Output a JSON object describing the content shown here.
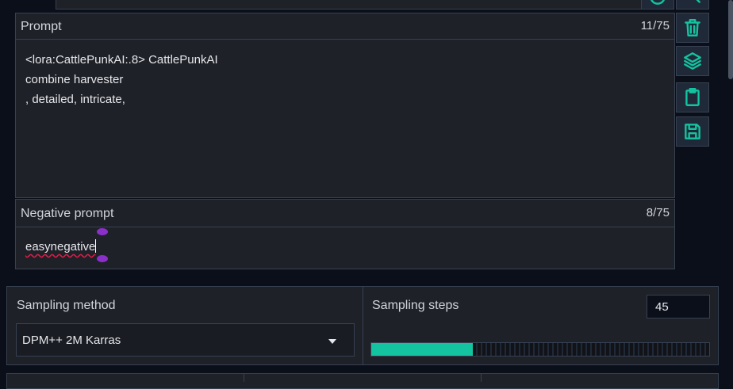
{
  "prompt": {
    "label": "Prompt",
    "counter": "11/75",
    "lines": [
      "<lora:CattlePunkAI:.8> CattlePunkAI",
      "combine harvester",
      ", detailed, intricate,"
    ]
  },
  "negative_prompt": {
    "label": "Negative prompt",
    "counter": "8/75",
    "value": "easynegative"
  },
  "toolbar": {
    "icons": [
      "refresh-icon",
      "trash-icon",
      "layers-icon",
      "clipboard-icon",
      "save-icon"
    ]
  },
  "sampling": {
    "method_label": "Sampling method",
    "method_value": "DPM++ 2M Karras",
    "steps_label": "Sampling steps",
    "steps_value": "45",
    "steps_progress": 0.3
  },
  "colors": {
    "accent": "#14c3a0",
    "background": "#0b0f19",
    "panel": "#1f2128"
  }
}
